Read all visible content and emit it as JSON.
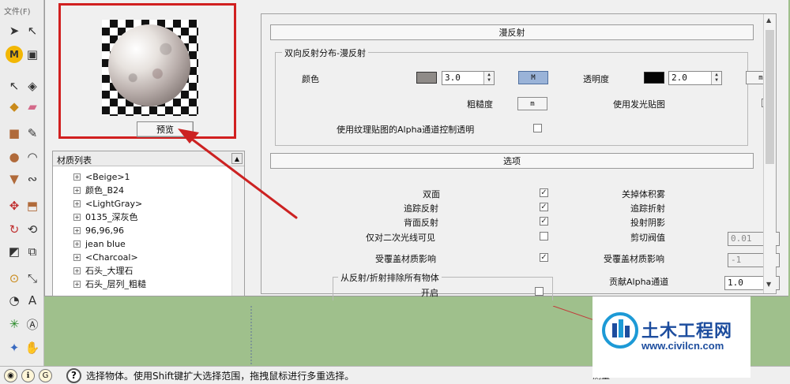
{
  "toolbar": {
    "menu_label": "文件(F)"
  },
  "preview": {
    "button_label": "预览"
  },
  "material_list": {
    "title": "材质列表",
    "items": [
      {
        "label": "<Beige>1"
      },
      {
        "label": "颜色_B24"
      },
      {
        "label": "<LightGray>"
      },
      {
        "label": "0135_深灰色"
      },
      {
        "label": "96,96,96"
      },
      {
        "label": "jean blue"
      },
      {
        "label": "<Charcoal>"
      },
      {
        "label": "石头_大理石"
      },
      {
        "label": "石头_层列_粗糙"
      }
    ]
  },
  "diffuse": {
    "header": "漫反射",
    "group_title": "双向反射分布-漫反射",
    "color_label": "颜色",
    "color_swatch": "#8f8b88",
    "color_value": "3.0",
    "color_map_label": "M",
    "transparency_label": "透明度",
    "transparency_swatch": "#050505",
    "transparency_value": "2.0",
    "transparency_map_label": "m",
    "roughness_label": "粗糙度",
    "roughness_map_label": "m",
    "use_emission_label": "使用发光贴图",
    "use_emission_checked": "✓",
    "alpha_label": "使用纹理贴图的Alpha通道控制透明",
    "alpha_checked": ""
  },
  "options": {
    "header": "选项",
    "double_sided": {
      "label": "双面",
      "mark": "✓"
    },
    "trace_reflection": {
      "label": "追踪反射",
      "mark": "✓"
    },
    "back_reflection": {
      "label": "背面反射",
      "mark": "✓"
    },
    "secondary_only": {
      "label": "仅对二次光线可见",
      "mark": ""
    },
    "override_material_left": {
      "label": "受覆盖材质影响",
      "mark": "✓"
    },
    "volume_fog": {
      "label": "关掉体积雾",
      "mark": ""
    },
    "trace_refraction": {
      "label": "追踪折射",
      "mark": "✓"
    },
    "cast_shadow": {
      "label": "投射阴影",
      "mark": "✓"
    },
    "clip_threshold": {
      "label": "剪切阀值",
      "value": "0.01"
    },
    "override_material_right": {
      "label": "受覆盖材质影响",
      "value": "-1"
    },
    "alpha_contribution": {
      "label": "贡献Alpha通道",
      "value": "1.0"
    },
    "exclude_group": {
      "title": "从反射/折射排除所有物体",
      "enable_label": "开启"
    }
  },
  "statusbar": {
    "message": "选择物体。使用Shift键扩大选择范围，拖拽鼠标进行多重选择。",
    "right_text": "测量"
  },
  "watermark": {
    "name": "土木工程网",
    "url": "www.civilcn.com"
  },
  "colors": {
    "highlight_border": "#d12020",
    "arrow": "#cc2222",
    "scene_bg": "#9fc08c",
    "brand": "#1d4d9e"
  }
}
